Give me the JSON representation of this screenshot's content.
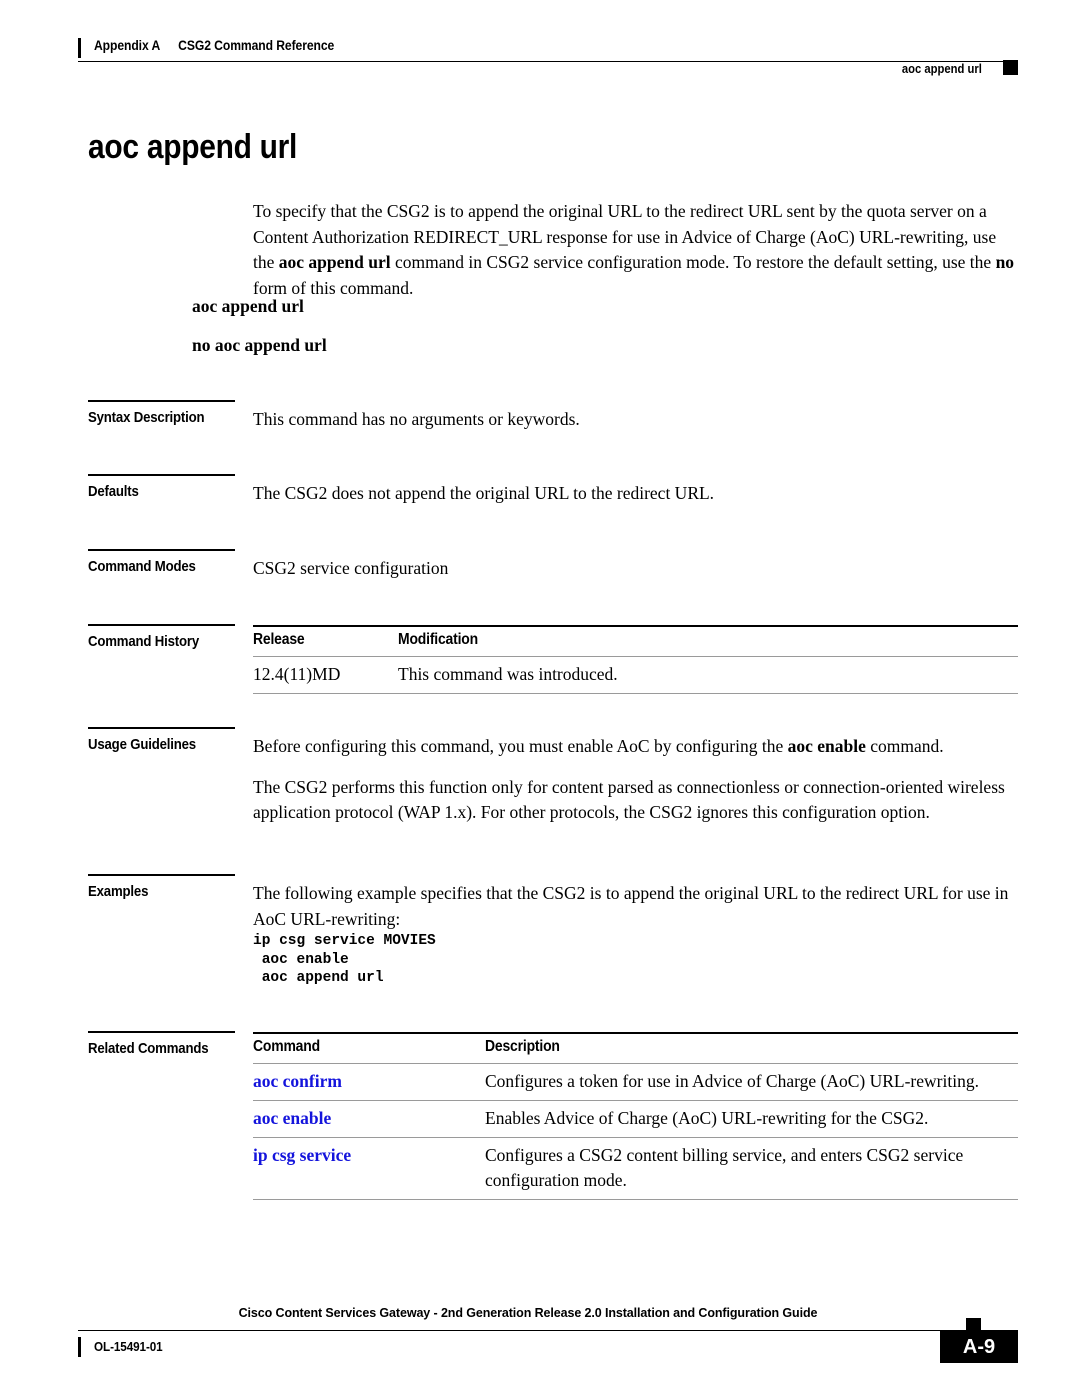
{
  "header": {
    "appendix": "Appendix A",
    "appendix_title": "CSG2 Command Reference",
    "running_head": "aoc append url"
  },
  "title": "aoc append url",
  "intro": {
    "part1": "To specify that the CSG2 is to append the original URL to the redirect URL sent by the quota server on a Content Authorization REDIRECT_URL response for use in Advice of Charge (AoC) URL-rewriting, use the ",
    "bold1": "aoc append url",
    "part2": " command in CSG2 service configuration mode. To restore the default setting, use the ",
    "bold2": "no",
    "part3": " form of this command."
  },
  "syntax": {
    "affirmative": "aoc append url",
    "negative": "no aoc append url"
  },
  "sections": {
    "syntax_description": {
      "label": "Syntax Description",
      "text": "This command has no arguments or keywords."
    },
    "defaults": {
      "label": "Defaults",
      "text": "The CSG2 does not append the original URL to the redirect URL."
    },
    "command_modes": {
      "label": "Command Modes",
      "text": "CSG2 service configuration"
    },
    "command_history": {
      "label": "Command History",
      "columns": [
        "Release",
        "Modification"
      ],
      "rows": [
        {
          "release": "12.4(11)MD",
          "modification": "This command was introduced."
        }
      ]
    },
    "usage_guidelines": {
      "label": "Usage Guidelines",
      "para1_pre": "Before configuring this command, you must enable AoC by configuring the ",
      "para1_bold": "aoc enable",
      "para1_post": " command.",
      "para2": "The CSG2 performs this function only for content parsed as connectionless or connection-oriented wireless application protocol (WAP 1.x). For other protocols, the CSG2 ignores this configuration option."
    },
    "examples": {
      "label": "Examples",
      "intro": "The following example specifies that the CSG2 is to append the original URL to the redirect URL for use in AoC URL-rewriting:",
      "code": "ip csg service MOVIES\n aoc enable\n aoc append url"
    },
    "related_commands": {
      "label": "Related Commands",
      "columns": [
        "Command",
        "Description"
      ],
      "rows": [
        {
          "command": "aoc confirm",
          "description": "Configures a token for use in Advice of Charge (AoC) URL-rewriting."
        },
        {
          "command": "aoc enable",
          "description": "Enables Advice of Charge (AoC) URL-rewriting for the CSG2."
        },
        {
          "command": "ip csg service",
          "description": "Configures a CSG2 content billing service, and enters CSG2 service configuration mode."
        }
      ]
    }
  },
  "footer": {
    "guide_title": "Cisco Content Services Gateway - 2nd Generation Release 2.0 Installation and Configuration Guide",
    "doc_id": "OL-15491-01",
    "page_number": "A-9"
  },
  "colors": {
    "link": "#1414dc",
    "rule": "#000000",
    "table_rule": "#9a9a9a"
  }
}
